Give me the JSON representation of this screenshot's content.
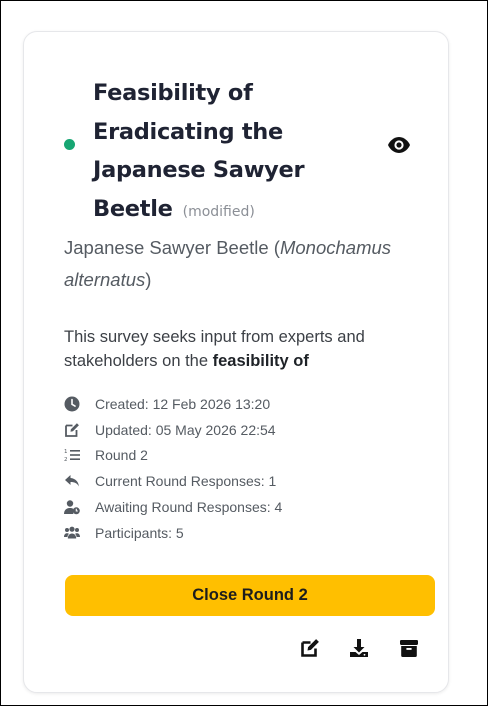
{
  "survey": {
    "title": "Feasibility of Eradicating the Japanese Sawyer Beetle",
    "modified_label": "(modified)",
    "species_common": "Japanese Sawyer Beetle (",
    "species_scientific": "Monochamus alternatus",
    "species_close": ")",
    "description_lead": "This survey seeks input from experts and stakeholders on the ",
    "description_bold": "feasibility of",
    "status_color": "#17a673"
  },
  "meta": {
    "created": "Created: 12 Feb 2026 13:20",
    "updated": "Updated: 05 May 2026 22:54",
    "round": "Round 2",
    "current_responses": "Current Round Responses: 1",
    "awaiting_responses": "Awaiting Round Responses: 4",
    "participants": "Participants: 5"
  },
  "actions": {
    "close_round_label": "Close Round 2",
    "icons": [
      "view-eye-icon",
      "edit-icon",
      "download-icon",
      "archive-icon"
    ]
  },
  "colors": {
    "accent": "#ffbf00",
    "status": "#17a673"
  }
}
